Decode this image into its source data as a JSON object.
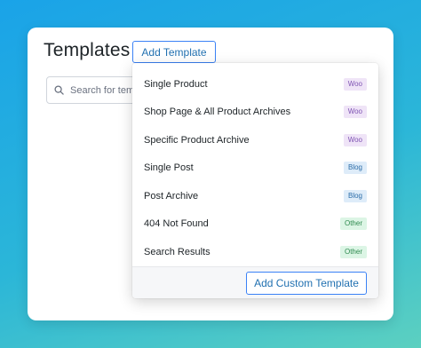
{
  "header": {
    "title": "Templates",
    "add_button_label": "Add Template"
  },
  "search": {
    "placeholder": "Search for temp",
    "icon": "search-icon"
  },
  "dropdown": {
    "items": [
      {
        "label": "Single Product",
        "badge": "Woo",
        "type": "woo"
      },
      {
        "label": "Shop Page & All Product Archives",
        "badge": "Woo",
        "type": "woo"
      },
      {
        "label": "Specific Product Archive",
        "badge": "Woo",
        "type": "woo"
      },
      {
        "label": "Single Post",
        "badge": "Blog",
        "type": "blog"
      },
      {
        "label": "Post Archive",
        "badge": "Blog",
        "type": "blog"
      },
      {
        "label": "404 Not Found",
        "badge": "Other",
        "type": "other"
      },
      {
        "label": "Search Results",
        "badge": "Other",
        "type": "other"
      }
    ],
    "footer_button_label": "Add Custom Template"
  },
  "colors": {
    "accent": "#3b82f6",
    "woo_badge": "#7f54b3",
    "blog_badge": "#2a6ca8",
    "other_badge": "#2e8a4f"
  }
}
